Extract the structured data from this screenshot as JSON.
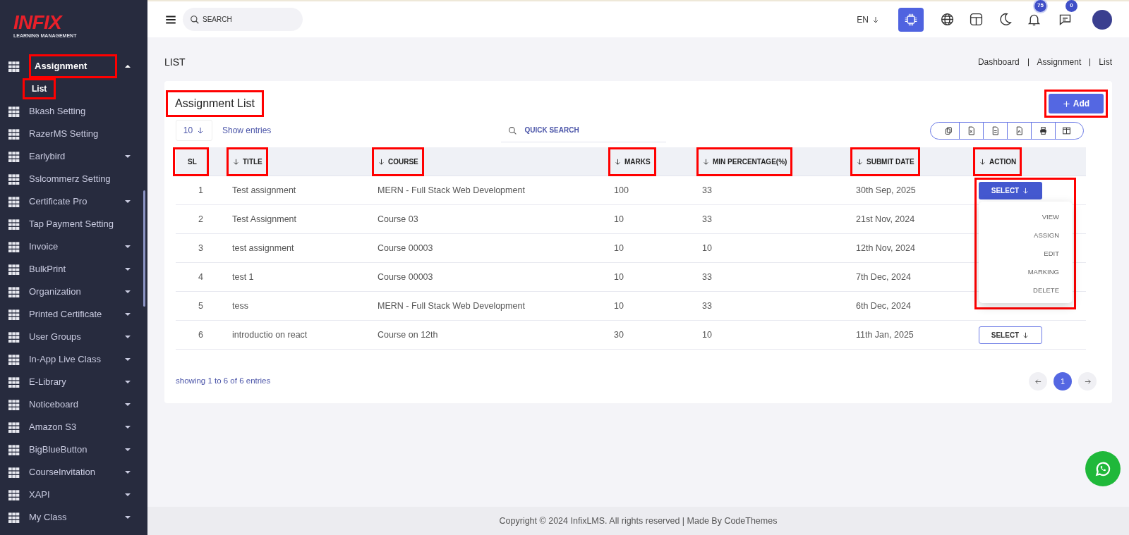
{
  "sidebar": {
    "logo": {
      "name": "INFIX",
      "tagline": "LEARNING MANAGEMENT"
    },
    "items": [
      {
        "label": "Assignment",
        "expanded": true,
        "highlighted": true,
        "children": [
          {
            "label": "List",
            "selected": true,
            "highlighted": true
          }
        ]
      },
      {
        "label": "Bkash Setting"
      },
      {
        "label": "RazerMS Setting"
      },
      {
        "label": "Earlybird",
        "expanded": false
      },
      {
        "label": "Sslcommerz Setting"
      },
      {
        "label": "Certificate Pro",
        "expanded": false
      },
      {
        "label": "Tap Payment Setting"
      },
      {
        "label": "Invoice",
        "expanded": false
      },
      {
        "label": "BulkPrint",
        "expanded": false
      },
      {
        "label": "Organization",
        "expanded": false
      },
      {
        "label": "Printed Certificate",
        "expanded": false
      },
      {
        "label": "User Groups",
        "expanded": false
      },
      {
        "label": "In-App Live Class",
        "expanded": false
      },
      {
        "label": "E-Library",
        "expanded": false
      },
      {
        "label": "Noticeboard",
        "expanded": false
      },
      {
        "label": "Amazon S3",
        "expanded": false
      },
      {
        "label": "BigBlueButton",
        "expanded": false
      },
      {
        "label": "CourseInvitation",
        "expanded": false
      },
      {
        "label": "XAPI",
        "expanded": false
      },
      {
        "label": "My Class",
        "expanded": false
      }
    ]
  },
  "header": {
    "search": {
      "placeholder": "SEARCH"
    },
    "language": "EN",
    "notifications": "75",
    "messages": "0"
  },
  "page": {
    "title": "LIST",
    "breadcrumb": [
      "Dashboard",
      "Assignment",
      "List"
    ]
  },
  "card": {
    "title": "Assignment List",
    "title_highlighted": true,
    "add_button": {
      "label": "Add",
      "highlighted": true
    },
    "entries": {
      "value": "10",
      "label": "Show entries"
    },
    "quick_search": {
      "placeholder": "QUICK SEARCH"
    },
    "columns": [
      {
        "label": "SL",
        "sortable": false,
        "highlighted": true
      },
      {
        "label": "TITLE",
        "sortable": true,
        "highlighted": true
      },
      {
        "label": "COURSE",
        "sortable": true,
        "highlighted": true
      },
      {
        "label": "MARKS",
        "sortable": true,
        "highlighted": true
      },
      {
        "label": "MIN PERCENTAGE(%)",
        "sortable": true,
        "highlighted": true
      },
      {
        "label": "SUBMIT DATE",
        "sortable": true,
        "highlighted": true
      },
      {
        "label": "ACTION",
        "sortable": true,
        "highlighted": true
      }
    ],
    "rows": [
      {
        "sl": "1",
        "title": "Test assignment",
        "course": "MERN - Full Stack Web Development",
        "marks": "100",
        "min_percentage": "33",
        "submit_date": "30th Sep, 2025",
        "action": {
          "label": "SELECT",
          "expanded": true,
          "highlighted": true,
          "menu": [
            "VIEW",
            "ASSIGN",
            "EDIT",
            "MARKING",
            "DELETE"
          ]
        }
      },
      {
        "sl": "2",
        "title": "Test Assignment",
        "course": "Course 03",
        "marks": "10",
        "min_percentage": "33",
        "submit_date": "21st Nov, 2024"
      },
      {
        "sl": "3",
        "title": "test assignment",
        "course": "Course 00003",
        "marks": "10",
        "min_percentage": "10",
        "submit_date": "12th Nov, 2024"
      },
      {
        "sl": "4",
        "title": "test 1",
        "course": "Course 00003",
        "marks": "10",
        "min_percentage": "33",
        "submit_date": "7th Dec, 2024"
      },
      {
        "sl": "5",
        "title": "tess",
        "course": "MERN - Full Stack Web Development",
        "marks": "10",
        "min_percentage": "33",
        "submit_date": "6th Dec, 2024"
      },
      {
        "sl": "6",
        "title": "introductio on react",
        "course": "Course on 12th",
        "marks": "30",
        "min_percentage": "10",
        "submit_date": "11th Jan, 2025",
        "action": {
          "label": "SELECT",
          "expanded": false
        }
      }
    ],
    "summary": "showing 1 to 6 of 6 entries",
    "pages": [
      {
        "label": "1",
        "selected": true
      }
    ]
  },
  "footer": "Copyright © 2024 InfixLMS. All rights reserved | Made By CodeThemes"
}
